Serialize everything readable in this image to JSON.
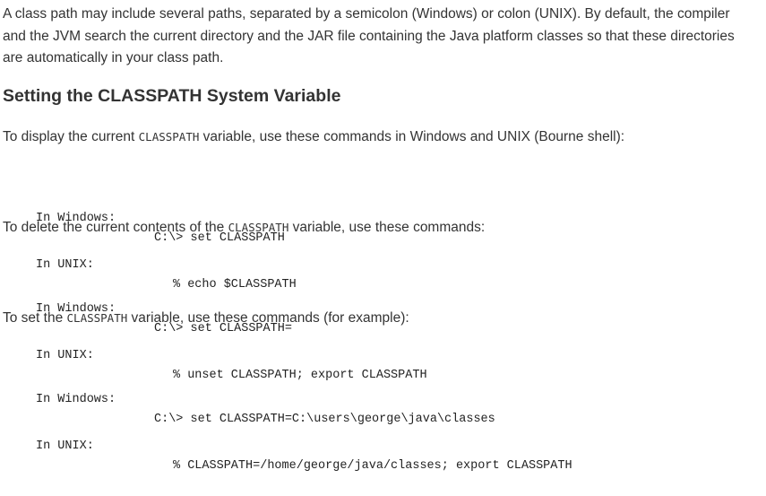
{
  "intro": {
    "line1": "A class path may include several paths, separated by a semicolon (Windows) or colon (UNIX). By default, the compiler",
    "line2": "and the JVM search the current directory and the JAR file containing the Java platform classes so that these directories",
    "line3": "are automatically in your class path."
  },
  "section_heading": "Setting the CLASSPATH System Variable",
  "display": {
    "before": "To display the current ",
    "code": "CLASSPATH",
    "after": " variable, use these commands in Windows and UNIX (Bourne shell):",
    "windows_label": "In Windows:",
    "windows_cmd": "C:\\> set CLASSPATH",
    "unix_label": "In UNIX:",
    "unix_cmd": "% echo $CLASSPATH"
  },
  "delete": {
    "before": "To delete the current contents of the ",
    "code": "CLASSPATH",
    "after": " variable, use these commands:",
    "windows_label": "In Windows:",
    "windows_cmd": "C:\\> set CLASSPATH=",
    "unix_label": "In UNIX:",
    "unix_cmd": "% unset CLASSPATH; export CLASSPATH"
  },
  "set": {
    "before": "To set the ",
    "code": "CLASSPATH",
    "after": " variable, use these commands (for example):",
    "windows_label": "In Windows:",
    "windows_cmd": "C:\\> set CLASSPATH=C:\\users\\george\\java\\classes",
    "unix_label": "In UNIX:",
    "unix_cmd": "% CLASSPATH=/home/george/java/classes; export CLASSPATH"
  }
}
